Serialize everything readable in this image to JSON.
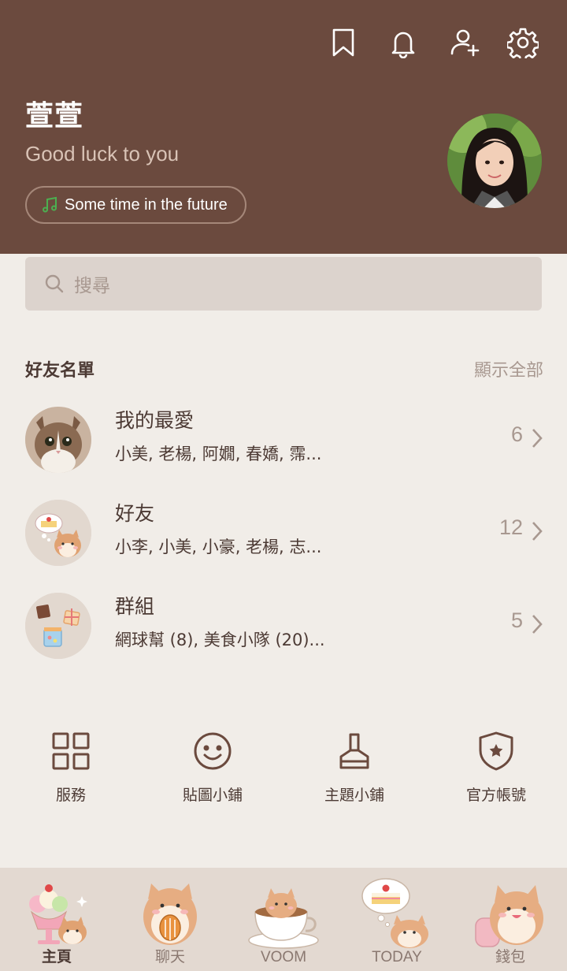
{
  "header": {
    "icons": [
      "bookmark-icon",
      "bell-icon",
      "add-friend-icon",
      "gear-icon"
    ],
    "profile_name": "萱萱",
    "status_message": "Good luck to you",
    "music": "Some time in the future"
  },
  "colors": {
    "header_bg": "#6b4a3e",
    "page_bg": "#f1ede8",
    "text_primary": "#4c3a34",
    "text_secondary": "#a89890",
    "music_note": "#4caf50"
  },
  "search": {
    "placeholder": "搜尋"
  },
  "friends": {
    "title": "好友名單",
    "show_all": "顯示全部",
    "rows": [
      {
        "title": "我的最愛",
        "members": "小美, 老楊, 阿嫺, 春嬌, 霈...",
        "count": "6"
      },
      {
        "title": "好友",
        "members": "小李, 小美, 小豪, 老楊, 志...",
        "count": "12"
      },
      {
        "title": "群組",
        "members": "網球幫 (8), 美食小隊 (20)...",
        "count": "5"
      }
    ]
  },
  "quick_actions": [
    {
      "label": "服務",
      "icon": "grid-icon"
    },
    {
      "label": "貼圖小鋪",
      "icon": "smiley-icon"
    },
    {
      "label": "主題小鋪",
      "icon": "brush-icon"
    },
    {
      "label": "官方帳號",
      "icon": "shield-star-icon"
    }
  ],
  "tabs": [
    {
      "label": "主頁",
      "active": true
    },
    {
      "label": "聊天",
      "active": false
    },
    {
      "label": "VOOM",
      "active": false
    },
    {
      "label": "TODAY",
      "active": false
    },
    {
      "label": "錢包",
      "active": false
    }
  ]
}
